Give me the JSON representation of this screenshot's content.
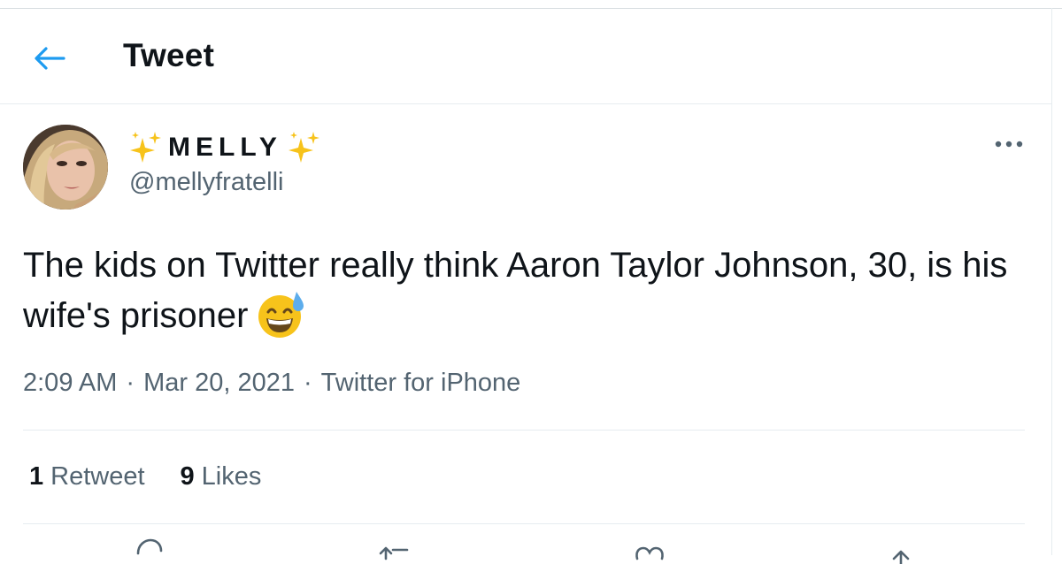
{
  "header": {
    "title": "Tweet",
    "back_icon": "arrow-left-icon",
    "accent_color": "#1d9bf0"
  },
  "tweet": {
    "author": {
      "display_name": "MELLY",
      "name_decoration_icon": "sparkles-icon",
      "handle": "@mellyfratelli"
    },
    "text": "The kids on Twitter really think Aaron Taylor Johnson, 30, is his wife's prisoner",
    "text_emoji": "grinning-face-with-sweat-icon",
    "time": "2:09 AM",
    "date": "Mar 20, 2021",
    "source": "Twitter for iPhone",
    "separator": "·",
    "stats": {
      "retweets_count": "1",
      "retweets_label": "Retweet",
      "likes_count": "9",
      "likes_label": "Likes"
    },
    "actions": [
      "reply-icon",
      "retweet-icon",
      "like-icon",
      "share-icon"
    ],
    "more_icon": "more-horizontal-icon"
  }
}
